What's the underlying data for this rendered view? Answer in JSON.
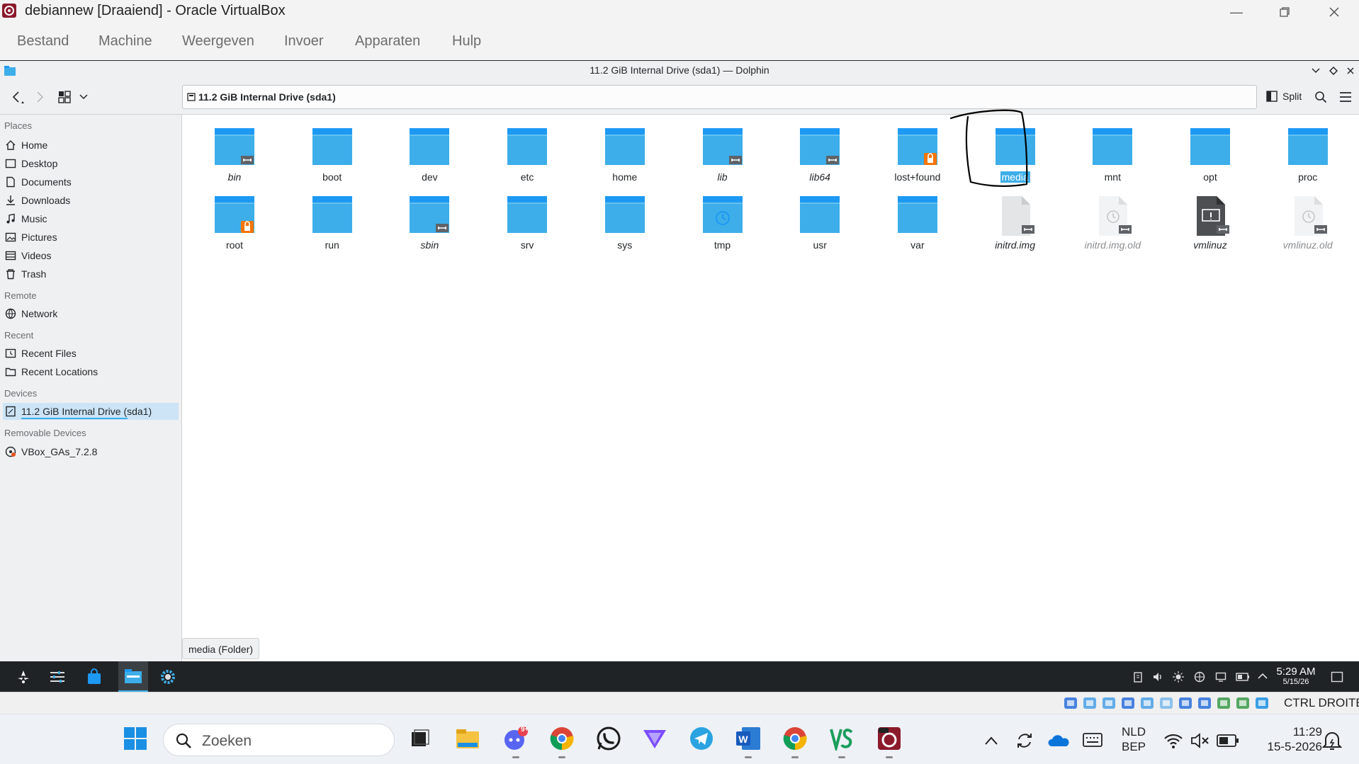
{
  "host_window": {
    "title": "debiannew [Draaiend] - Oracle VirtualBox",
    "menu": [
      "Bestand",
      "Machine",
      "Weergeven",
      "Invoer",
      "Apparaten",
      "Hulp"
    ]
  },
  "dolphin": {
    "window_title": "11.2 GiB Internal Drive (sda1) — Dolphin",
    "location": "11.2 GiB Internal Drive (sda1)",
    "split_label": "Split",
    "sidebar": {
      "places_header": "Places",
      "places": [
        "Home",
        "Desktop",
        "Documents",
        "Downloads",
        "Music",
        "Pictures",
        "Videos",
        "Trash"
      ],
      "remote_header": "Remote",
      "remote": [
        "Network"
      ],
      "recent_header": "Recent",
      "recent": [
        "Recent Files",
        "Recent Locations"
      ],
      "devices_header": "Devices",
      "devices": [
        "11.2 GiB Internal Drive (sda1)"
      ],
      "removable_header": "Removable Devices",
      "removable": [
        "VBox_GAs_7.2.8"
      ]
    },
    "items": [
      {
        "name": "bin",
        "type": "folder",
        "symlink": true,
        "italic": true
      },
      {
        "name": "boot",
        "type": "folder"
      },
      {
        "name": "dev",
        "type": "folder"
      },
      {
        "name": "etc",
        "type": "folder"
      },
      {
        "name": "home",
        "type": "folder"
      },
      {
        "name": "lib",
        "type": "folder",
        "symlink": true,
        "italic": true
      },
      {
        "name": "lib64",
        "type": "folder",
        "symlink": true,
        "italic": true
      },
      {
        "name": "lost+found",
        "type": "folder",
        "locked": true
      },
      {
        "name": "media",
        "type": "folder",
        "selected": true
      },
      {
        "name": "mnt",
        "type": "folder"
      },
      {
        "name": "opt",
        "type": "folder"
      },
      {
        "name": "proc",
        "type": "folder"
      },
      {
        "name": "root",
        "type": "folder",
        "locked": true
      },
      {
        "name": "run",
        "type": "folder"
      },
      {
        "name": "sbin",
        "type": "folder",
        "symlink": true,
        "italic": true
      },
      {
        "name": "srv",
        "type": "folder"
      },
      {
        "name": "sys",
        "type": "folder"
      },
      {
        "name": "tmp",
        "type": "folder-temp"
      },
      {
        "name": "usr",
        "type": "folder"
      },
      {
        "name": "var",
        "type": "folder"
      },
      {
        "name": "initrd.img",
        "type": "file",
        "symlink": true,
        "italic": true
      },
      {
        "name": "initrd.img.old",
        "type": "file-broken",
        "symlink": true,
        "italic": true,
        "dim": true
      },
      {
        "name": "vmlinuz",
        "type": "file-dark",
        "symlink": true,
        "italic": true
      },
      {
        "name": "vmlinuz.old",
        "type": "file-broken",
        "symlink": true,
        "italic": true,
        "dim": true
      }
    ],
    "status": "media (Folder)"
  },
  "guest_panel": {
    "time": "5:29 AM",
    "date": "5/15/26"
  },
  "vb_status": {
    "host_key": "CTRL DROITE"
  },
  "host_taskbar": {
    "search_placeholder": "Zoeken",
    "discord_badge": "9+",
    "lang_1": "NLD",
    "lang_2": "BEP",
    "time": "11:29",
    "date": "15-5-2026"
  },
  "colors": {
    "folder": "#3daee9",
    "folder_tab": "#1d99f3",
    "selection": "#3daee9",
    "panel_bg": "#202326"
  }
}
